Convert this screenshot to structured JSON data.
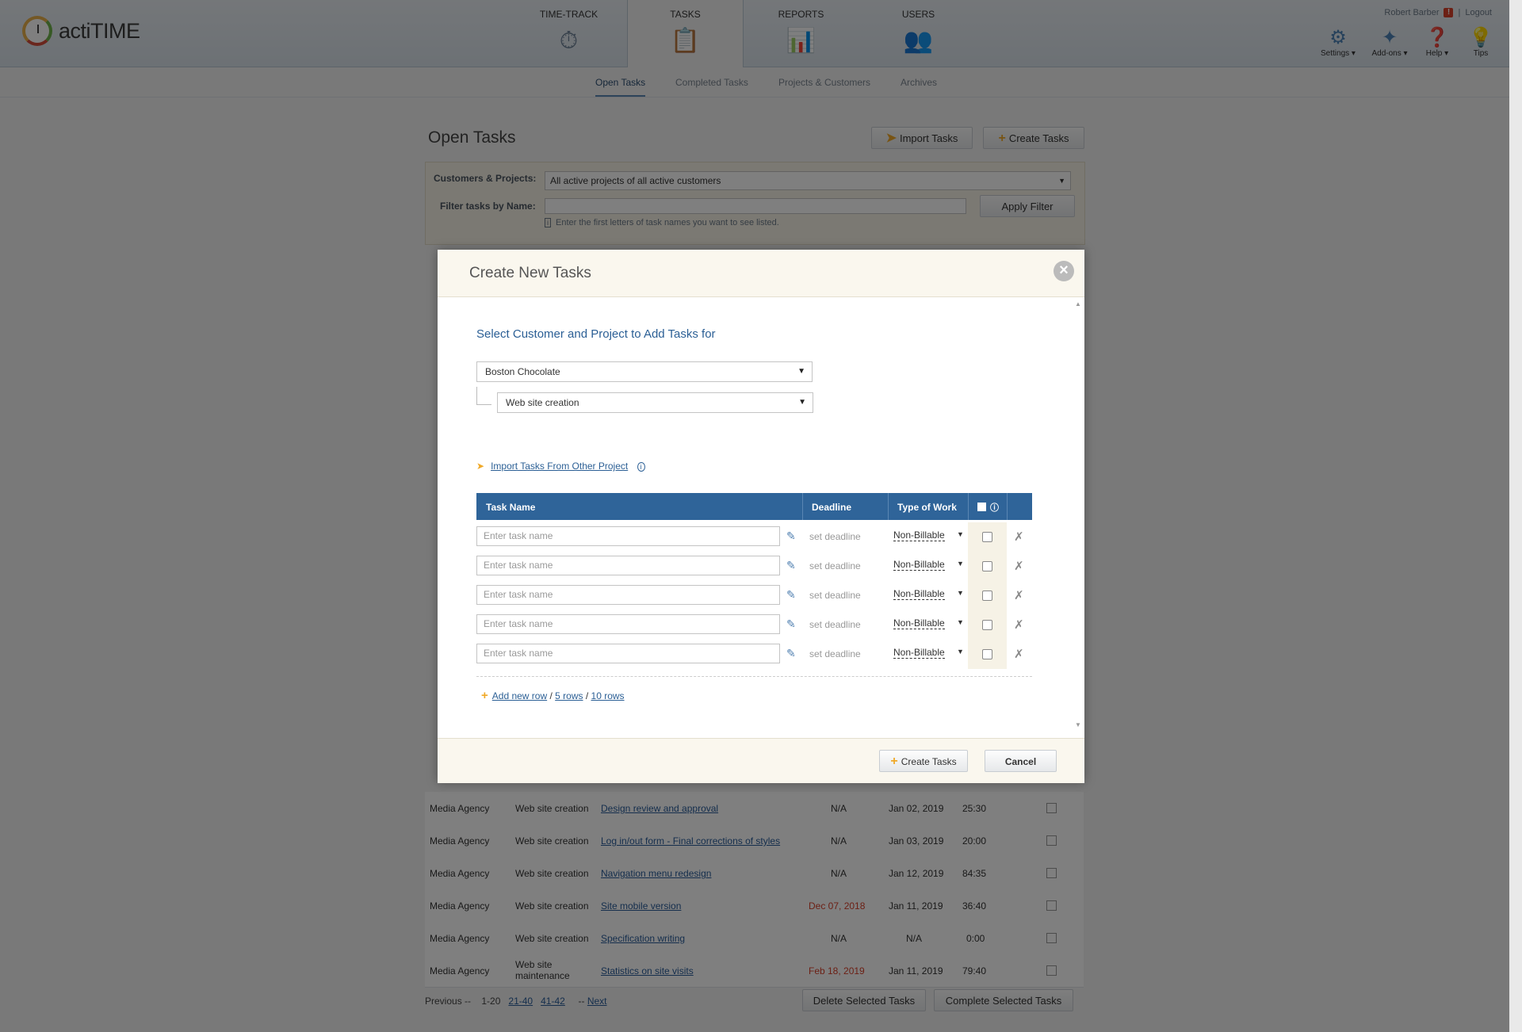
{
  "app": {
    "name": "actiTIME"
  },
  "nav": {
    "tabs": [
      {
        "label": "TIME-TRACK",
        "icon": "stopwatch-icon"
      },
      {
        "label": "TASKS",
        "icon": "clipboard-icon"
      },
      {
        "label": "REPORTS",
        "icon": "chart-icon"
      },
      {
        "label": "USERS",
        "icon": "users-icon"
      }
    ],
    "user": "Robert Barber",
    "logout": "Logout",
    "tools": [
      {
        "label": "Settings",
        "icon": "gear-icon"
      },
      {
        "label": "Add-ons",
        "icon": "puzzle-icon"
      },
      {
        "label": "Help",
        "icon": "help-icon"
      },
      {
        "label": "Tips",
        "icon": "lightbulb-icon"
      }
    ]
  },
  "subnav": [
    "Open Tasks",
    "Completed Tasks",
    "Projects & Customers",
    "Archives"
  ],
  "page": {
    "title": "Open Tasks",
    "import_label": "Import Tasks",
    "create_label": "Create Tasks",
    "filter": {
      "customers_label": "Customers & Projects:",
      "customers_value": "All active projects of all active customers",
      "name_label": "Filter tasks by Name:",
      "apply_label": "Apply Filter",
      "hint": "Enter the first letters of task names you want to see listed."
    },
    "rows": [
      {
        "customer": "Media Agency",
        "project": "Web site creation",
        "task": "Design review and approval",
        "deadline": "N/A",
        "created": "Jan 02, 2019",
        "time": "25:30"
      },
      {
        "customer": "Media Agency",
        "project": "Web site creation",
        "task": "Log in/out form - Final corrections of styles",
        "deadline": "N/A",
        "created": "Jan 03, 2019",
        "time": "20:00"
      },
      {
        "customer": "Media Agency",
        "project": "Web site creation",
        "task": "Navigation menu redesign",
        "deadline": "N/A",
        "created": "Jan 12, 2019",
        "time": "84:35"
      },
      {
        "customer": "Media Agency",
        "project": "Web site creation",
        "task": "Site mobile version",
        "deadline": "Dec 07, 2018",
        "created": "Jan 11, 2019",
        "time": "36:40"
      },
      {
        "customer": "Media Agency",
        "project": "Web site creation",
        "task": "Specification writing",
        "deadline": "N/A",
        "created": "N/A",
        "time": "0:00"
      },
      {
        "customer": "Media Agency",
        "project": "Web site maintenance",
        "task": "Statistics on site visits",
        "deadline": "Feb 18, 2019",
        "created": "Jan 11, 2019",
        "time": "79:40"
      }
    ],
    "pager": {
      "prev": "Previous --",
      "current": "1-20",
      "p2": "21-40",
      "p3": "41-42",
      "next": "Next",
      "next_prefix": "--"
    },
    "delete_label": "Delete Selected Tasks",
    "complete_label": "Complete Selected Tasks"
  },
  "modal": {
    "title": "Create New Tasks",
    "section_title": "Select Customer and Project to Add Tasks for",
    "customer": "Boston Chocolate",
    "project": "Web site creation",
    "import_link": "Import Tasks From Other Project",
    "columns": {
      "task_name": "Task Name",
      "deadline": "Deadline",
      "type_of_work": "Type of Work"
    },
    "rows": [
      {
        "placeholder": "Enter task name",
        "deadline": "set deadline",
        "type": "Non-Billable"
      },
      {
        "placeholder": "Enter task name",
        "deadline": "set deadline",
        "type": "Non-Billable"
      },
      {
        "placeholder": "Enter task name",
        "deadline": "set deadline",
        "type": "Non-Billable"
      },
      {
        "placeholder": "Enter task name",
        "deadline": "set deadline",
        "type": "Non-Billable"
      },
      {
        "placeholder": "Enter task name",
        "deadline": "set deadline",
        "type": "Non-Billable"
      }
    ],
    "add_row": "Add new row",
    "five_rows": "5 rows",
    "ten_rows": "10 rows",
    "create_label": "Create Tasks",
    "cancel_label": "Cancel"
  },
  "colors": {
    "header_blue": "#2f6499",
    "link": "#2b5f95",
    "accent": "#f0a928",
    "overdue": "#d9412b"
  }
}
